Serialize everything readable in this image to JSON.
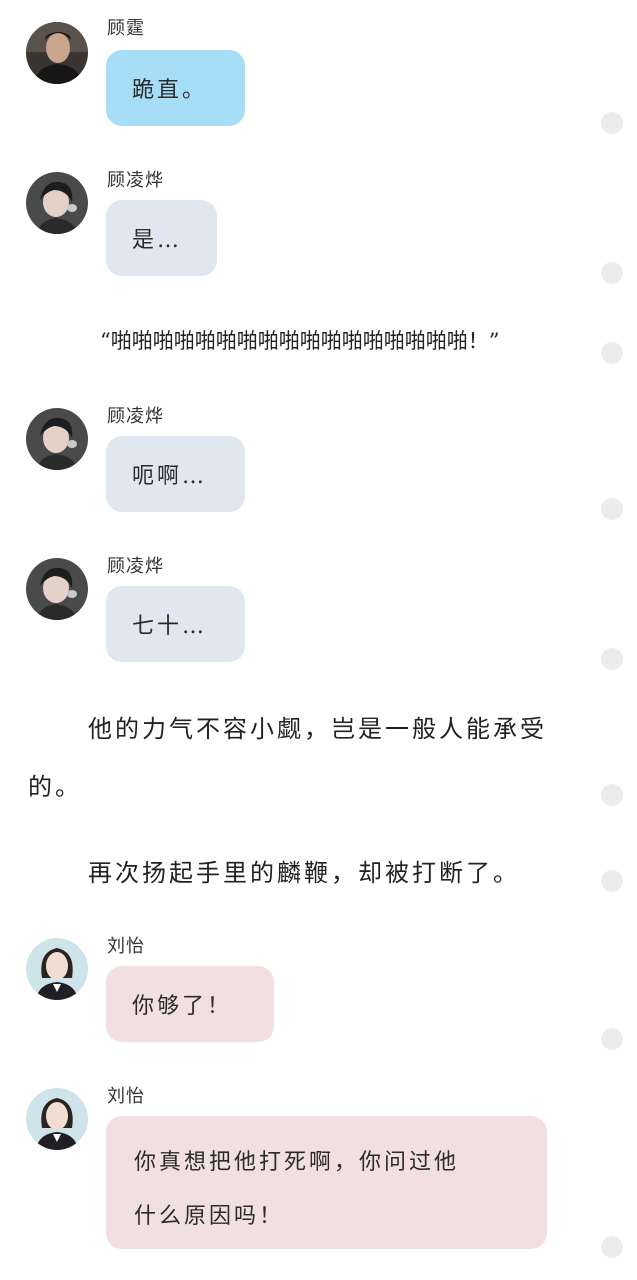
{
  "colors": {
    "bubble_gu_ting": "#a8ddf8",
    "bubble_gu_linghua": "#e0e7f0",
    "bubble_liu_yi": "#f2dfe1",
    "side_dot": "#ececec"
  },
  "messages": [
    {
      "sender": "顾霆",
      "text": "跪直。",
      "avatar": "avatar-man-icon"
    },
    {
      "sender": "顾凌烨",
      "text": "是…",
      "avatar": "avatar-boy-icon"
    },
    {
      "sender": "顾凌烨",
      "text": "呃啊…",
      "avatar": "avatar-boy-icon"
    },
    {
      "sender": "顾凌烨",
      "text": "七十…",
      "avatar": "avatar-boy-icon"
    },
    {
      "sender": "刘怡",
      "text": "你够了！",
      "avatar": "avatar-woman-icon"
    },
    {
      "sender": "刘怡",
      "lines": [
        "你真想把他打死啊，你问过他",
        "什么原因吗！"
      ],
      "avatar": "avatar-woman-icon"
    }
  ],
  "narration": {
    "sound": "“啪啪啪啪啪啪啪啪啪啪啪啪啪啪啪啪啪！”",
    "strength_line1": "他的力气不容小觑，岂是一般人能承受",
    "strength_line2": "的。",
    "interrupted": "再次扬起手里的麟鞭，却被打断了。"
  }
}
